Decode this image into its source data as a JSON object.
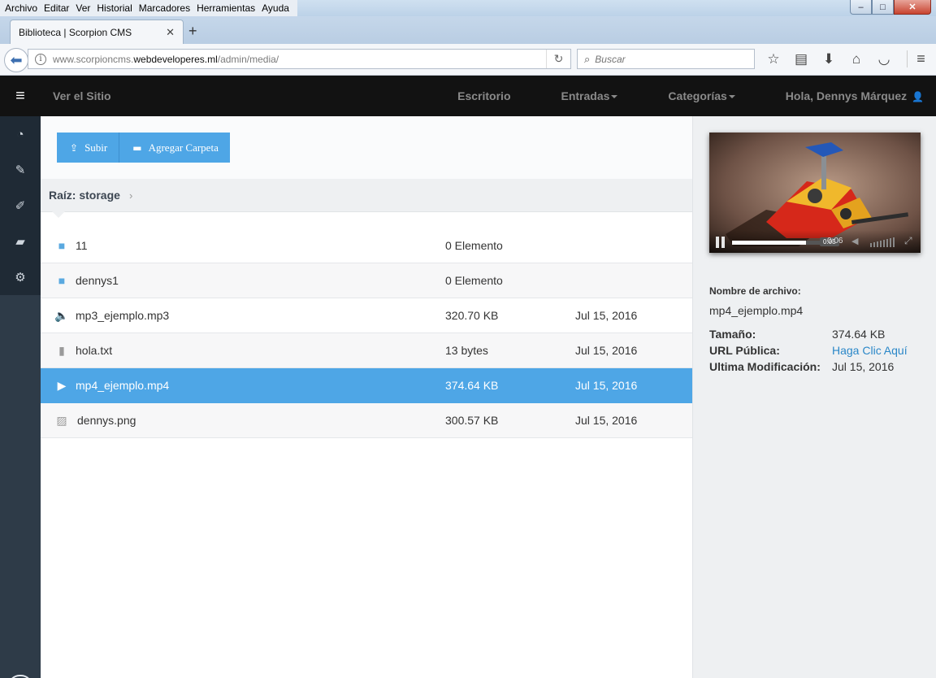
{
  "browser": {
    "menu": [
      "Archivo",
      "Editar",
      "Ver",
      "Historial",
      "Marcadores",
      "Herramientas",
      "Ayuda"
    ],
    "tab_title": "Biblioteca | Scorpion CMS",
    "url_prefix": "www.scorpioncms.",
    "url_domain": "webdeveloperes.ml",
    "url_path": "/admin/media/",
    "search_placeholder": "Buscar",
    "window_controls": {
      "minimize": "–",
      "maximize": "□",
      "close": "✕"
    }
  },
  "cms_nav": {
    "view_site": "Ver el Sitio",
    "items": [
      {
        "label": "Escritorio",
        "dropdown": false
      },
      {
        "label": "Entradas",
        "dropdown": true
      },
      {
        "label": "Categorías",
        "dropdown": true
      },
      {
        "label": "Hola, Dennys Márquez",
        "dropdown": false,
        "icon": "user-icon"
      }
    ]
  },
  "sidebar": {
    "items": [
      {
        "name": "dashboard-icon",
        "glyph": "◔"
      },
      {
        "name": "edit-icon",
        "glyph": "✎"
      },
      {
        "name": "brush-icon",
        "glyph": "🖌"
      },
      {
        "name": "folder-open-icon",
        "glyph": "📂"
      },
      {
        "name": "settings-icon",
        "glyph": "⚙"
      }
    ]
  },
  "actions": {
    "upload_label": "Subir",
    "add_folder_label": "Agregar Carpeta"
  },
  "breadcrumb": {
    "root": "Raíz: storage",
    "separator": "›"
  },
  "files": [
    {
      "icon": "folder-icon",
      "name": "11",
      "size": "0 Elemento",
      "date": "",
      "selected": false
    },
    {
      "icon": "folder-icon",
      "name": "dennys1",
      "size": "0 Elemento",
      "date": "",
      "selected": false
    },
    {
      "icon": "audio-file-icon",
      "name": "mp3_ejemplo.mp3",
      "size": "320.70 KB",
      "date": "Jul 15, 2016",
      "selected": false
    },
    {
      "icon": "text-file-icon",
      "name": "hola.txt",
      "size": "13 bytes",
      "date": "Jul 15, 2016",
      "selected": false
    },
    {
      "icon": "video-file-icon",
      "name": "mp4_ejemplo.mp4",
      "size": "374.64 KB",
      "date": "Jul 15, 2016",
      "selected": true
    },
    {
      "icon": "image-file-icon",
      "name": "dennys.png",
      "size": "300.57 KB",
      "date": "Jul 15, 2016",
      "selected": false
    }
  ],
  "player": {
    "tooltip_time": "0:05",
    "current_time": "0:06",
    "progress_fraction": 0.83
  },
  "details": {
    "filename_label": "Nombre de archivo:",
    "filename": "mp4_ejemplo.mp4",
    "size_label": "Tamaño:",
    "size": "374.64 KB",
    "url_label": "URL Pública:",
    "url_link": "Haga Clic Aquí",
    "modified_label": "Ultima Modificación:",
    "modified": "Jul 15, 2016"
  },
  "colors": {
    "accent": "#4ea6e6",
    "navbar": "#121212",
    "sidebar": "#2e3b48",
    "link": "#2a87c8"
  }
}
